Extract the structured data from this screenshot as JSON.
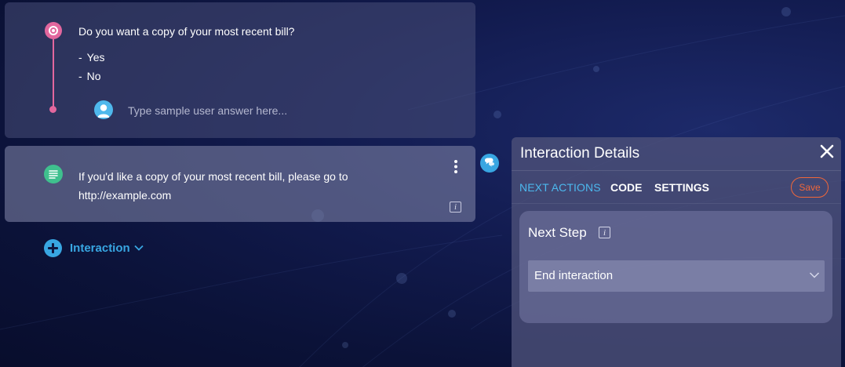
{
  "flow": {
    "question": {
      "text": "Do you want a copy of your most recent bill?",
      "options": [
        {
          "dash": "-",
          "label": "Yes"
        },
        {
          "dash": "-",
          "label": "No"
        }
      ],
      "answer_placeholder": "Type sample user answer here...",
      "answer_value": ""
    },
    "message": {
      "line1": "If you'd like a copy of your most recent bill, please go to",
      "line2": "http://example.com",
      "info_glyph": "i"
    },
    "add_interaction": {
      "label": "Interaction"
    }
  },
  "panel": {
    "title": "Interaction Details",
    "tabs": [
      {
        "label": "NEXT ACTIONS",
        "active": true
      },
      {
        "label": "CODE",
        "active": false
      },
      {
        "label": "SETTINGS",
        "active": false
      }
    ],
    "save_label": "Save",
    "next_step": {
      "label": "Next Step",
      "info_glyph": "i",
      "selected": "End interaction"
    }
  },
  "colors": {
    "question_accent": "#e2679e",
    "message_accent": "#3fc08e",
    "link_blue": "#38a6e2",
    "active_tab": "#4cb8ee",
    "save_orange": "#f0673a"
  },
  "icons": {
    "question": "question-node-icon",
    "message": "message-node-icon",
    "user": "user-avatar-icon",
    "menu": "kebab-menu-icon",
    "info": "info-icon",
    "chat": "chat-bubble-icon",
    "add": "plus-circle-icon",
    "chevron": "chevron-down-icon",
    "close": "close-icon"
  }
}
